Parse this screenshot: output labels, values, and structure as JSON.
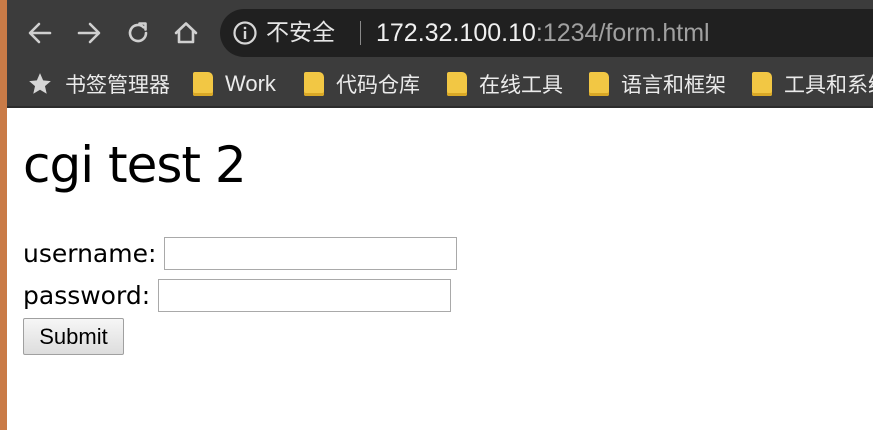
{
  "toolbar": {
    "back_icon": "arrow-left-icon",
    "forward_icon": "arrow-right-icon",
    "reload_icon": "reload-icon",
    "home_icon": "home-icon"
  },
  "omnibox": {
    "security_icon": "info-circle-icon",
    "security_text": "不安全",
    "url_host": "172.32.100.10",
    "url_rest": ":1234/form.html"
  },
  "bookmarks": {
    "manager_label": "书签管理器",
    "items": [
      {
        "label": "Work"
      },
      {
        "label": "代码仓库"
      },
      {
        "label": "在线工具"
      },
      {
        "label": "语言和框架"
      },
      {
        "label": "工具和系统"
      }
    ]
  },
  "page": {
    "title": "cgi test 2",
    "username_label": "username:",
    "username_value": "",
    "password_label": "password:",
    "password_value": "",
    "submit_label": "Submit"
  },
  "colors": {
    "chrome_bg": "#3c3c3c",
    "omnibox_bg": "#202020",
    "folder": "#f2c744",
    "window_edge": "#c97b47"
  }
}
